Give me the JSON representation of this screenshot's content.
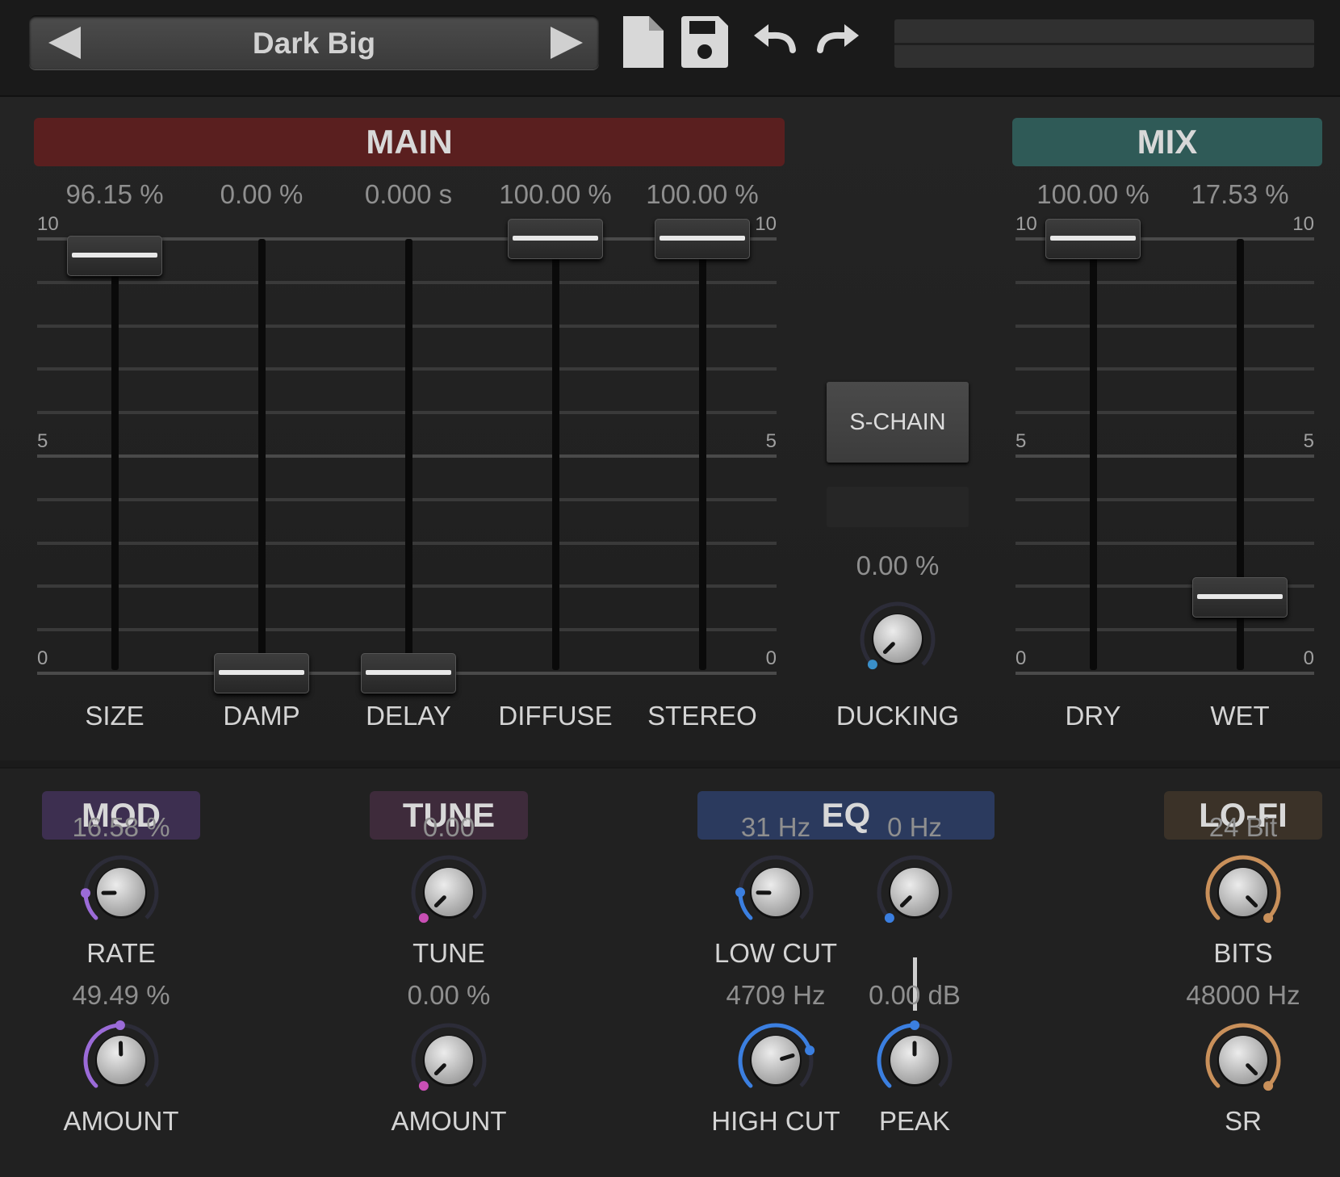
{
  "preset": {
    "name": "Dark Big"
  },
  "toolbar": {
    "icons": [
      "prev-preset",
      "next-preset",
      "new-file",
      "save",
      "undo",
      "redo"
    ]
  },
  "main": {
    "title": "MAIN",
    "color": "#5a1f1f",
    "scale": {
      "top": "10",
      "mid": "5",
      "bottom": "0"
    },
    "faders": [
      {
        "id": "size",
        "label": "SIZE",
        "value": "96.15 %",
        "level": 0.9615
      },
      {
        "id": "damp",
        "label": "DAMP",
        "value": "0.00 %",
        "level": 0.0
      },
      {
        "id": "delay",
        "label": "DELAY",
        "value": "0.000 s",
        "level": 0.0
      },
      {
        "id": "diffuse",
        "label": "DIFFUSE",
        "value": "100.00 %",
        "level": 1.0
      },
      {
        "id": "stereo",
        "label": "STEREO",
        "value": "100.00 %",
        "level": 1.0
      }
    ]
  },
  "ducking": {
    "button": "S-CHAIN",
    "value": "0.00 %",
    "label": "DUCKING",
    "level": 0.0,
    "color": "#3a8fc8"
  },
  "mix": {
    "title": "MIX",
    "color": "#2f5a57",
    "scale": {
      "top": "10",
      "mid": "5",
      "bottom": "0"
    },
    "faders": [
      {
        "id": "dry",
        "label": "DRY",
        "value": "100.00 %",
        "level": 1.0
      },
      {
        "id": "wet",
        "label": "WET",
        "value": "17.53 %",
        "level": 0.1753
      }
    ]
  },
  "mod": {
    "title": "MOD",
    "color": "#3d2f50",
    "accent": "#9b6bd8",
    "knobs": [
      {
        "id": "rate",
        "label": "RATE",
        "value": "16.58 %",
        "level": 0.1658
      },
      {
        "id": "amount",
        "label": "AMOUNT",
        "value": "49.49 %",
        "level": 0.4949
      }
    ]
  },
  "tune": {
    "title": "TUNE",
    "color": "#3e2b3b",
    "accent": "#c94fb5",
    "knobs": [
      {
        "id": "tune",
        "label": "TUNE",
        "value": "0.00",
        "level": 0.0
      },
      {
        "id": "amount",
        "label": "AMOUNT",
        "value": "0.00 %",
        "level": 0.0
      }
    ]
  },
  "eq": {
    "title": "EQ",
    "color": "#2b3a5e",
    "accent": "#3b7fe0",
    "knobs": [
      {
        "id": "lowcut",
        "label": "LOW CUT",
        "value": "31 Hz",
        "level": 0.17
      },
      {
        "id": "peakfreq",
        "label": "",
        "value": "0 Hz",
        "level": 0.0
      },
      {
        "id": "highcut",
        "label": "HIGH CUT",
        "value": "4709 Hz",
        "level": 0.77
      },
      {
        "id": "peak",
        "label": "PEAK",
        "value": "0.00 dB",
        "level": 0.5
      }
    ]
  },
  "lofi": {
    "title": "LO-FI",
    "color": "#3b3228",
    "accent": "#c9905a",
    "knobs": [
      {
        "id": "bits",
        "label": "BITS",
        "value": "24 Bit",
        "level": 1.0
      },
      {
        "id": "sr",
        "label": "SR",
        "value": "48000 Hz",
        "level": 1.0
      }
    ]
  }
}
